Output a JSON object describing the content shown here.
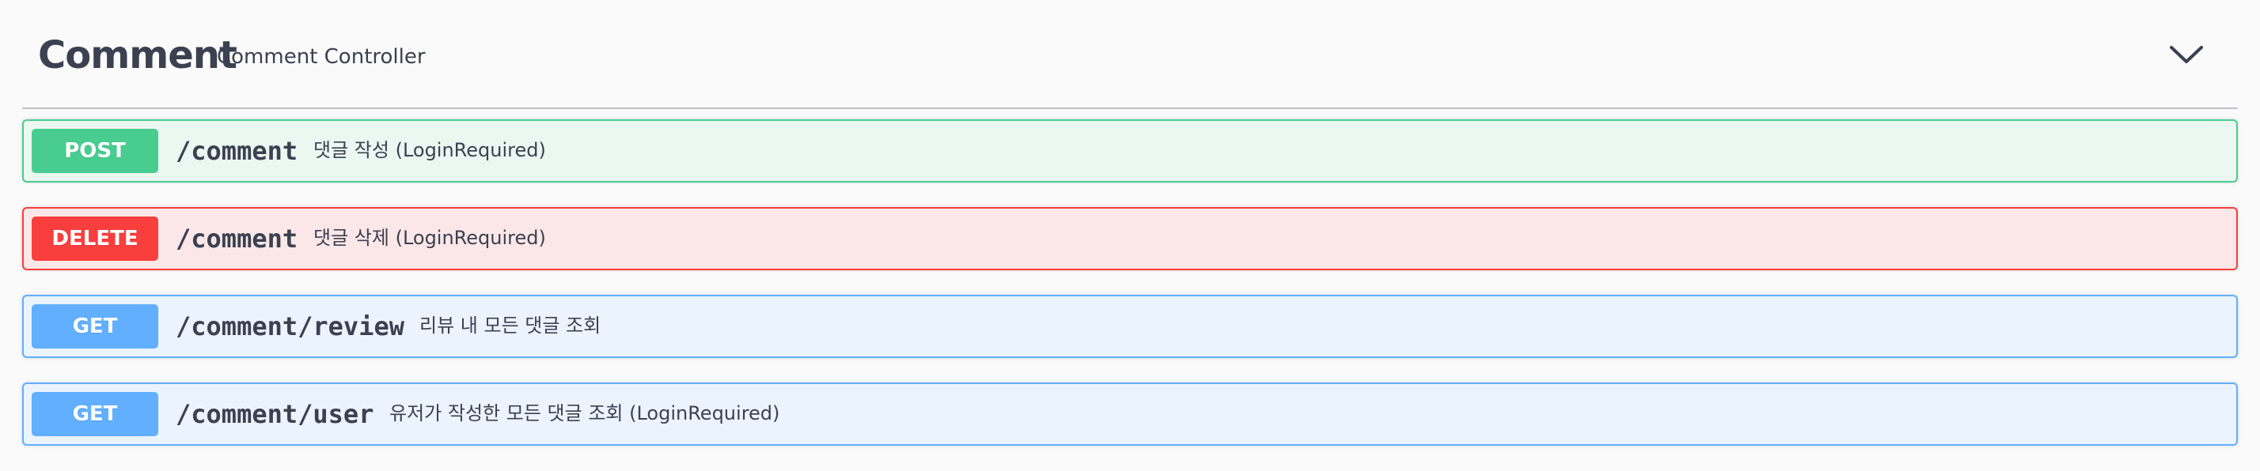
{
  "tag": {
    "title": "Comment",
    "description": "Comment Controller",
    "toggle_icon": "chevron-down-icon"
  },
  "operations": [
    {
      "method": "POST",
      "path": "/comment",
      "summary": "댓글 작성 (LoginRequired)",
      "color": "#49cc90"
    },
    {
      "method": "DELETE",
      "path": "/comment",
      "summary": "댓글 삭제 (LoginRequired)",
      "color": "#f93e3e"
    },
    {
      "method": "GET",
      "path": "/comment/review",
      "summary": "리뷰 내 모든 댓글 조회",
      "color": "#61affe"
    },
    {
      "method": "GET",
      "path": "/comment/user",
      "summary": "유저가 작성한 모든 댓글 조회 (LoginRequired)",
      "color": "#61affe"
    }
  ]
}
